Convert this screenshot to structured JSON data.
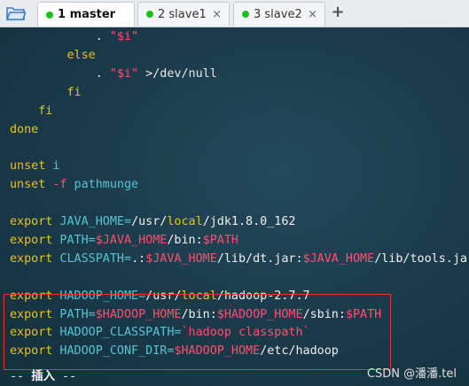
{
  "tabs": [
    {
      "label": "1 master",
      "active": true
    },
    {
      "label": "2 slave1",
      "active": false
    },
    {
      "label": "3 slave2",
      "active": false
    }
  ],
  "tab_close_glyph": "×",
  "add_tab_glyph": "+",
  "colors": {
    "status_dot": "#19c21e",
    "keyword": "#e8c31b",
    "identifier": "#56c5d2",
    "variable": "#ff4f6e",
    "highlight_box": "#d9363e"
  },
  "terminal": {
    "lines": [
      [
        {
          "t": "            . ",
          "c": "txt"
        },
        {
          "t": "\"$i\"",
          "c": "str"
        }
      ],
      [
        {
          "t": "        ",
          "c": "txt"
        },
        {
          "t": "else",
          "c": "kw"
        }
      ],
      [
        {
          "t": "            . ",
          "c": "txt"
        },
        {
          "t": "\"$i\"",
          "c": "str"
        },
        {
          "t": " >/dev/null",
          "c": "txt"
        }
      ],
      [
        {
          "t": "        ",
          "c": "txt"
        },
        {
          "t": "fi",
          "c": "kw"
        }
      ],
      [
        {
          "t": "    ",
          "c": "txt"
        },
        {
          "t": "fi",
          "c": "kw"
        }
      ],
      [
        {
          "t": "done",
          "c": "kw"
        }
      ],
      [],
      [
        {
          "t": "unset",
          "c": "kw"
        },
        {
          "t": " i",
          "c": "id"
        }
      ],
      [
        {
          "t": "unset",
          "c": "kw"
        },
        {
          "t": " -f",
          "c": "var"
        },
        {
          "t": " pathmunge",
          "c": "id"
        }
      ],
      [],
      [
        {
          "t": "export",
          "c": "kw"
        },
        {
          "t": " JAVA_HOME=",
          "c": "id"
        },
        {
          "t": "/usr/",
          "c": "pth"
        },
        {
          "t": "local",
          "c": "kw"
        },
        {
          "t": "/jdk1.8.0_162",
          "c": "pth"
        }
      ],
      [
        {
          "t": "export",
          "c": "kw"
        },
        {
          "t": " PATH=",
          "c": "id"
        },
        {
          "t": "$JAVA_HOME",
          "c": "var"
        },
        {
          "t": "/bin:",
          "c": "pth"
        },
        {
          "t": "$PATH",
          "c": "var"
        }
      ],
      [
        {
          "t": "export",
          "c": "kw"
        },
        {
          "t": " CLASSPATH=",
          "c": "id"
        },
        {
          "t": ".:",
          "c": "pth"
        },
        {
          "t": "$JAVA_HOME",
          "c": "var"
        },
        {
          "t": "/lib/dt.jar:",
          "c": "pth"
        },
        {
          "t": "$JAVA_HOME",
          "c": "var"
        },
        {
          "t": "/lib/tools.jar",
          "c": "pth"
        }
      ],
      [],
      [
        {
          "t": "export",
          "c": "kw"
        },
        {
          "t": " HADOOP_HOME=",
          "c": "id"
        },
        {
          "t": "/usr/",
          "c": "pth"
        },
        {
          "t": "local",
          "c": "kw"
        },
        {
          "t": "/hadoop-2.7.7",
          "c": "pth"
        }
      ],
      [
        {
          "t": "export",
          "c": "kw"
        },
        {
          "t": " PATH=",
          "c": "id"
        },
        {
          "t": "$HADOOP_HOME",
          "c": "var"
        },
        {
          "t": "/bin:",
          "c": "pth"
        },
        {
          "t": "$HADOOP_HOME",
          "c": "var"
        },
        {
          "t": "/sbin:",
          "c": "pth"
        },
        {
          "t": "$PATH",
          "c": "var"
        }
      ],
      [
        {
          "t": "export",
          "c": "kw"
        },
        {
          "t": " HADOOP_CLASSPATH=",
          "c": "id"
        },
        {
          "t": "`hadoop classpath`",
          "c": "var"
        }
      ],
      [
        {
          "t": "export",
          "c": "kw"
        },
        {
          "t": " HADOOP_CONF_DIR=",
          "c": "id"
        },
        {
          "t": "$HADOOP_HOME",
          "c": "var"
        },
        {
          "t": "/etc/hadoop",
          "c": "pth"
        }
      ]
    ],
    "status": {
      "prefix": "-- ",
      "mode": "插入",
      "suffix": " --"
    }
  },
  "watermark": "CSDN @潘潘.tel"
}
